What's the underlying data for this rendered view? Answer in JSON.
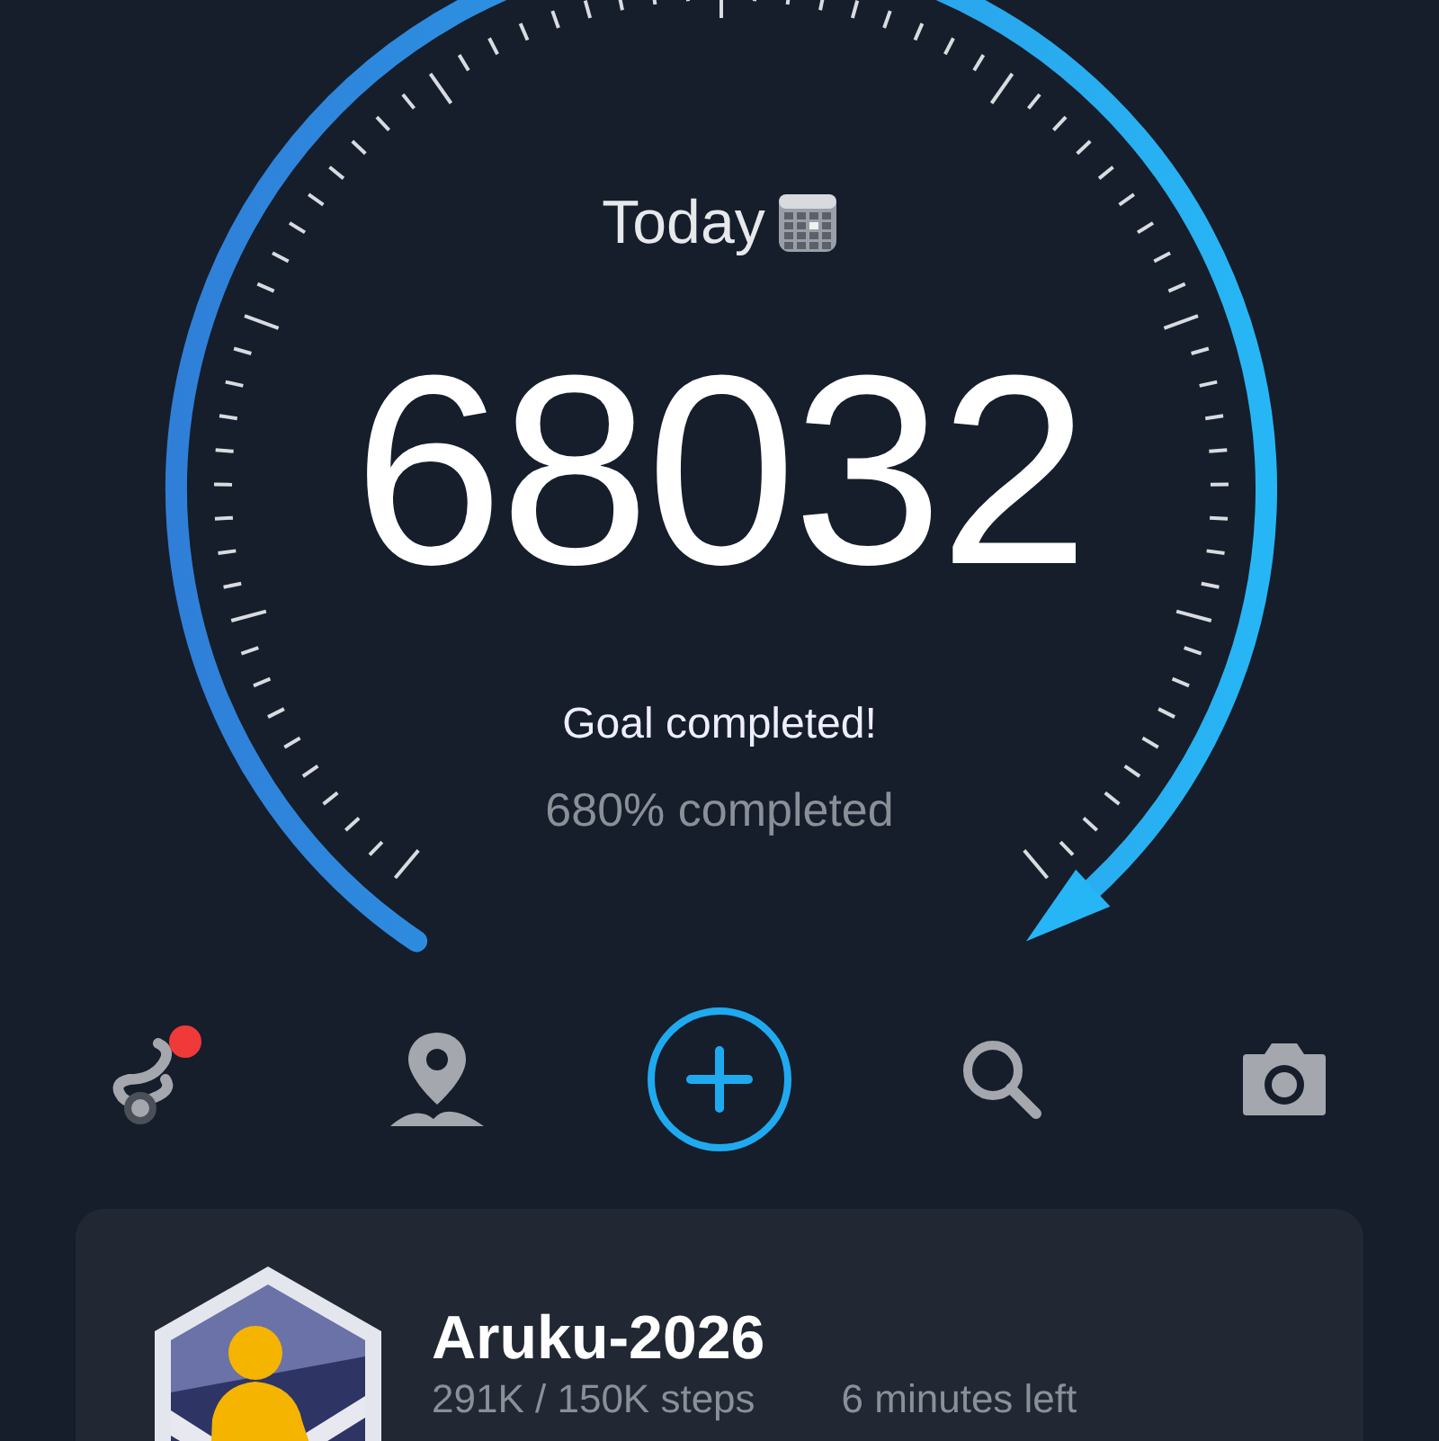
{
  "date_label": "Today",
  "steps": "68032",
  "goal_message": "Goal completed!",
  "progress_text": "680% completed",
  "toolbar": [
    {
      "kind": "routes",
      "notification": true
    },
    {
      "kind": "map",
      "notification": false
    },
    {
      "kind": "add",
      "notification": false
    },
    {
      "kind": "search",
      "notification": false
    },
    {
      "kind": "camera",
      "notification": false
    }
  ],
  "challenge": {
    "title": "Aruku-2026",
    "progress": "291K / 150K steps",
    "time_left": "6 minutes left"
  }
}
